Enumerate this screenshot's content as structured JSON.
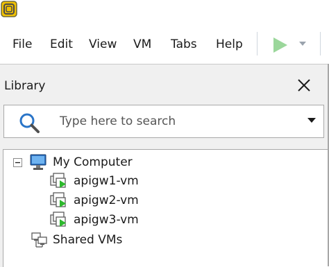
{
  "menu": {
    "items": [
      {
        "label": "File"
      },
      {
        "label": "Edit"
      },
      {
        "label": "View"
      },
      {
        "label": "VM"
      },
      {
        "label": "Tabs"
      },
      {
        "label": "Help"
      }
    ],
    "play_icon": "play-icon",
    "play_color": "#9bd79b"
  },
  "library": {
    "title": "Library",
    "close_icon": "close-icon",
    "search": {
      "placeholder": "Type here to search",
      "value": ""
    },
    "tree": {
      "root": {
        "label": "My Computer",
        "icon": "computer-icon",
        "expanded": true,
        "children": [
          {
            "label": "apigw1-vm",
            "icon": "vm-icon"
          },
          {
            "label": "apigw2-vm",
            "icon": "vm-icon"
          },
          {
            "label": "apigw3-vm",
            "icon": "vm-icon"
          }
        ]
      },
      "shared": {
        "label": "Shared VMs",
        "icon": "shared-vms-icon"
      }
    }
  },
  "colors": {
    "accent": "#1e78c8",
    "vm_play": "#2db82d",
    "panel_bg": "#f0f0f0"
  }
}
